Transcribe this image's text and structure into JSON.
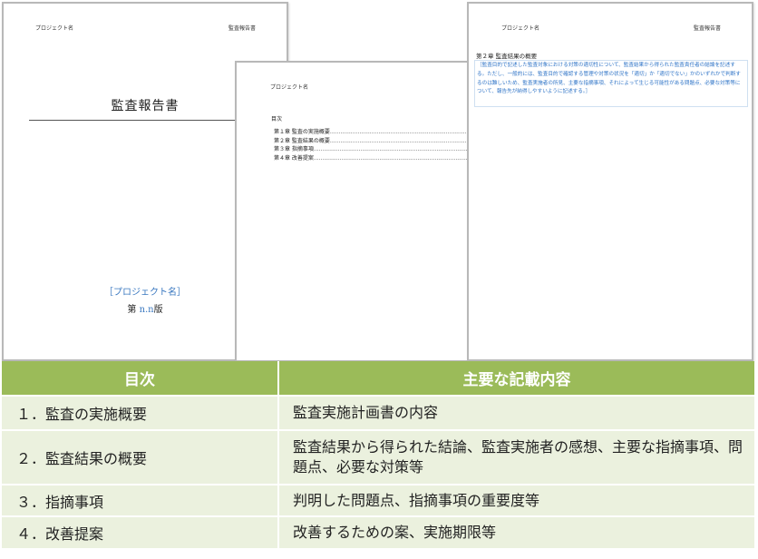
{
  "pages": {
    "cover": {
      "header_left": "プロジェクト名",
      "header_right": "監査報告書",
      "title": "監査報告書",
      "project_placeholder": "［プロジェクト名］",
      "version_prefix": "第",
      "version_number": "n.n",
      "version_suffix": "版"
    },
    "toc": {
      "header_left": "プロジェクト名",
      "title": "目次",
      "entries": [
        {
          "label": "第１章  監査の実施概要",
          "dots": "...................................................................................."
        },
        {
          "label": "第２章  監査結果の概要",
          "dots": "...................................................................................."
        },
        {
          "label": "第３章  指摘事項",
          "dots": "............................................................................................"
        },
        {
          "label": "第４章  改善提案",
          "dots": "............................................................................................"
        }
      ]
    },
    "summary": {
      "header_left": "プロジェクト名",
      "header_right": "監査報告書",
      "section_title": "第２章  監査結果の概要",
      "guidance": "［監査目的で記述した監査対象における対策の適切性について、監査結果から得られた監査責任者の結論を記述する。ただし、一般的には、監査目的で確認する管理や対策の状況を「適切」か「適切でない」かのいずれかで判断するのは難しいため、監査実施者の所見、主要な指摘事項、それによって生じる可能性がある問題点、必要な対策等について、報告先が納得しやすいように記述する。］"
    }
  },
  "table": {
    "headers": [
      "目次",
      "主要な記載内容"
    ],
    "rows": [
      {
        "item": "１．監査の実施概要",
        "content": "監査実施計画書の内容"
      },
      {
        "item": "２．監査結果の概要",
        "content": "監査結果から得られた結論、監査実施者の感想、主要な指摘事項、問題点、必要な対策等"
      },
      {
        "item": "３．指摘事項",
        "content": "判明した問題点、指摘事項の重要度等"
      },
      {
        "item": "４．改善提案",
        "content": "改善するための案、実施期限等"
      }
    ]
  },
  "colors": {
    "header_green": "#9bbb59",
    "row_green": "#ebf1de",
    "placeholder_blue": "#3a78c0"
  }
}
